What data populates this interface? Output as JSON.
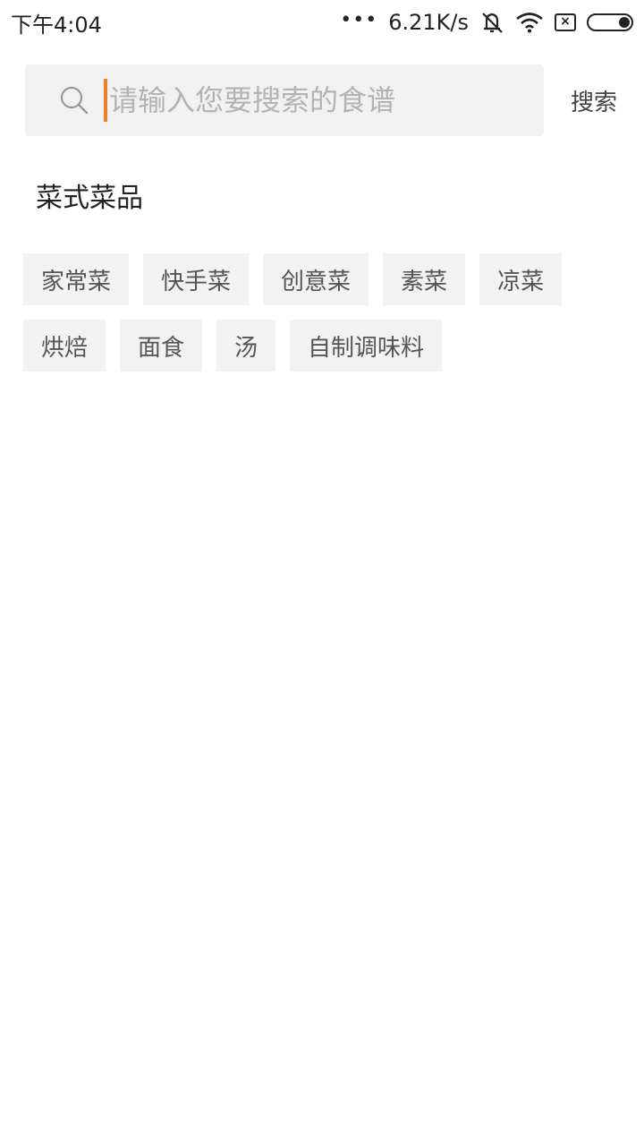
{
  "status_bar": {
    "time": "下午4:04",
    "more": "•••",
    "net_speed": "6.21K/s",
    "icons": [
      "mute-icon",
      "wifi-icon",
      "sim-x-icon",
      "battery-icon"
    ]
  },
  "search": {
    "placeholder": "请输入您要搜索的食谱",
    "button_label": "搜索",
    "accent": "#e8812d"
  },
  "section": {
    "title": "菜式菜品"
  },
  "tags": [
    "家常菜",
    "快手菜",
    "创意菜",
    "素菜",
    "凉菜",
    "烘焙",
    "面食",
    "汤",
    "自制调味料"
  ]
}
